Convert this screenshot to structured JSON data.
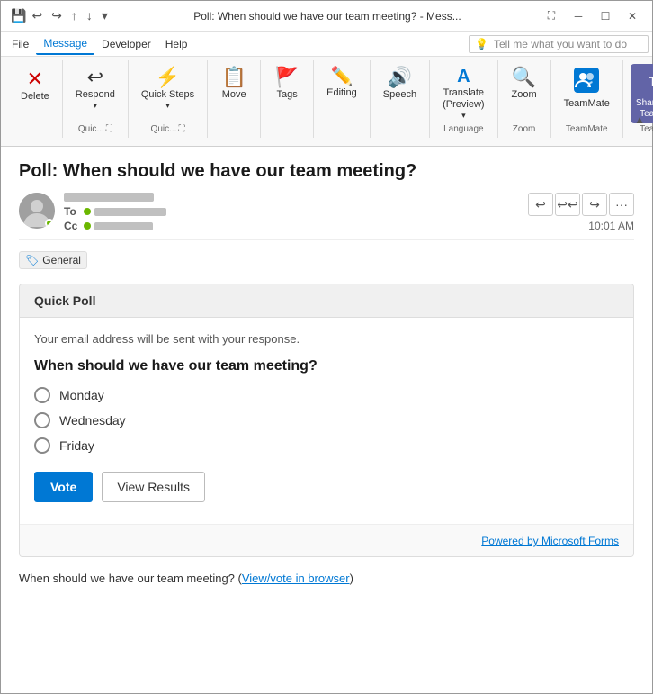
{
  "titleBar": {
    "title": "Poll: When should we have our team meeting? - Mess...",
    "saveIcon": "💾",
    "undoIcon": "↩",
    "redoIcon": "↪",
    "uploadIcon": "↑",
    "downloadIcon": "↓",
    "customizeIcon": "▼",
    "minimizeIcon": "─",
    "restoreIcon": "☐",
    "closeIcon": "✕"
  },
  "menuBar": {
    "items": [
      {
        "label": "File",
        "active": false
      },
      {
        "label": "Message",
        "active": true
      },
      {
        "label": "Developer",
        "active": false
      },
      {
        "label": "Help",
        "active": false
      }
    ],
    "tellMePlaceholder": "Tell me what you want to do",
    "lightbulbIcon": "💡"
  },
  "ribbon": {
    "groups": [
      {
        "name": "delete-group",
        "buttons": [
          {
            "id": "delete-btn",
            "icon": "✕",
            "label": "Delete",
            "type": "delete"
          }
        ],
        "groupLabel": ""
      },
      {
        "name": "respond-group",
        "buttons": [
          {
            "id": "respond-btn",
            "icon": "↩",
            "label": "Respond",
            "type": "large",
            "hasDropdown": true
          }
        ],
        "groupLabel": "Quic..."
      },
      {
        "name": "quick-steps-group",
        "buttons": [
          {
            "id": "quick-steps-btn",
            "icon": "⚡",
            "label": "Quick Steps",
            "type": "large",
            "hasDropdown": true
          }
        ],
        "groupLabel": "Quic..."
      },
      {
        "name": "move-group",
        "buttons": [
          {
            "id": "move-btn",
            "icon": "📋",
            "label": "Move",
            "type": "large",
            "hasDropdown": false
          }
        ],
        "groupLabel": ""
      },
      {
        "name": "tags-group",
        "buttons": [
          {
            "id": "tags-btn",
            "icon": "🚩",
            "label": "Tags",
            "type": "large",
            "hasDropdown": false
          }
        ],
        "groupLabel": ""
      },
      {
        "name": "editing-group",
        "buttons": [
          {
            "id": "editing-btn",
            "icon": "✏️",
            "label": "Editing",
            "type": "large"
          }
        ],
        "groupLabel": ""
      },
      {
        "name": "speech-group",
        "buttons": [
          {
            "id": "speech-btn",
            "icon": "🔊",
            "label": "Speech",
            "type": "large"
          }
        ],
        "groupLabel": ""
      },
      {
        "name": "language-group",
        "buttons": [
          {
            "id": "translate-btn",
            "icon": "A",
            "label": "Translate (Preview)",
            "type": "large",
            "hasDropdown": true
          }
        ],
        "groupLabel": "Language"
      },
      {
        "name": "zoom-group",
        "buttons": [
          {
            "id": "zoom-btn",
            "icon": "🔍",
            "label": "Zoom",
            "type": "large"
          }
        ],
        "groupLabel": "Zoom"
      },
      {
        "name": "teammate-group",
        "buttons": [
          {
            "id": "teammate-btn",
            "icon": "👥",
            "label": "TeamMate",
            "type": "large"
          }
        ],
        "groupLabel": "TeamMate"
      },
      {
        "name": "teams-group",
        "buttons": [
          {
            "id": "share-teams-btn",
            "icon": "T",
            "label": "Share to Teams",
            "type": "teams"
          }
        ],
        "groupLabel": "Teams"
      }
    ],
    "collapseIcon": "▲"
  },
  "email": {
    "subject": "Poll: When should we have our team meeting?",
    "time": "10:01 AM",
    "tag": "General",
    "tagIcon": "🏷"
  },
  "poll": {
    "cardTitle": "Quick Poll",
    "disclaimer": "Your email address will be sent with your response.",
    "question": "When should we have our team meeting?",
    "options": [
      "Monday",
      "Wednesday",
      "Friday"
    ],
    "voteLabel": "Vote",
    "viewResultsLabel": "View Results",
    "poweredBy": "Powered by Microsoft Forms"
  },
  "footer": {
    "text": "When should we have our team meeting? (",
    "linkText": "View/vote in browser",
    "textEnd": ")"
  }
}
